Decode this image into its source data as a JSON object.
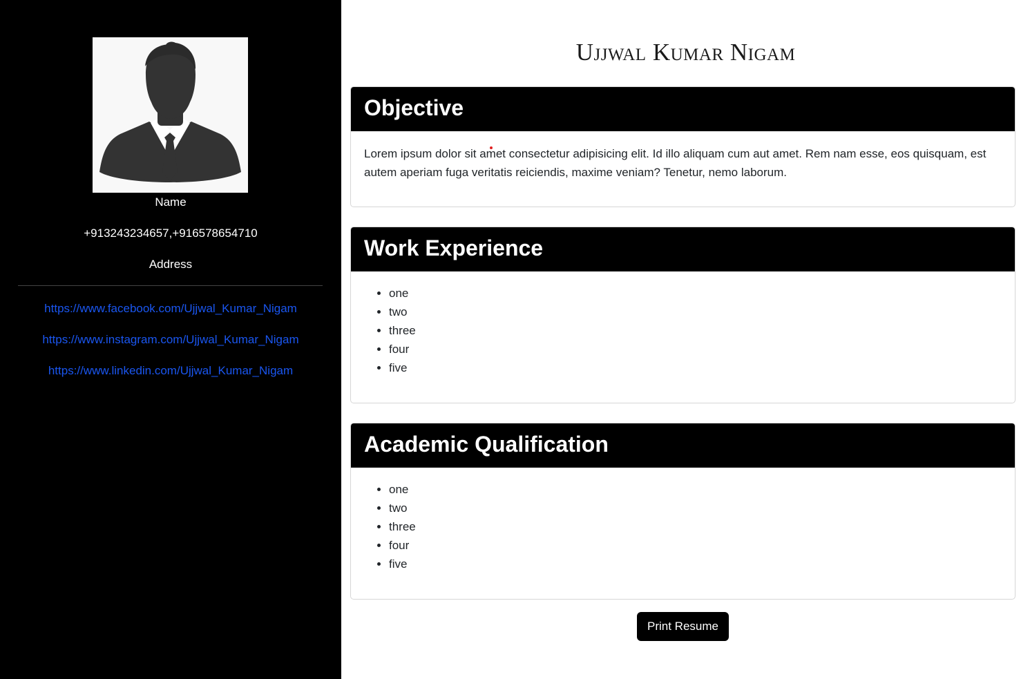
{
  "sidebar": {
    "name": "Name",
    "phone": "+913243234657,+916578654710",
    "address": "Address",
    "links": [
      "https://www.facebook.com/Ujjwal_Kumar_Nigam",
      "https://www.instagram.com/Ujjwal_Kumar_Nigam",
      "https://www.linkedin.com/Ujjwal_Kumar_Nigam"
    ],
    "avatar_icon": "person-silhouette-icon"
  },
  "main": {
    "title": "Ujjwal Kumar Nigam",
    "objective": {
      "heading": "Objective",
      "text": "Lorem ipsum dolor sit amet consectetur adipisicing elit. Id illo aliquam cum aut amet. Rem nam esse, eos quisquam, est autem aperiam fuga veritatis reiciendis, maxime veniam? Tenetur, nemo laborum."
    },
    "work_experience": {
      "heading": "Work Experience",
      "items": [
        "one",
        "two",
        "three",
        "four",
        "five"
      ]
    },
    "academic_qualification": {
      "heading": "Academic Qualification",
      "items": [
        "one",
        "two",
        "three",
        "four",
        "five"
      ]
    },
    "print_button": "Print Resume"
  },
  "colors": {
    "sidebar_bg": "#000000",
    "link": "#1a56f0",
    "card_header_bg": "#000000"
  }
}
